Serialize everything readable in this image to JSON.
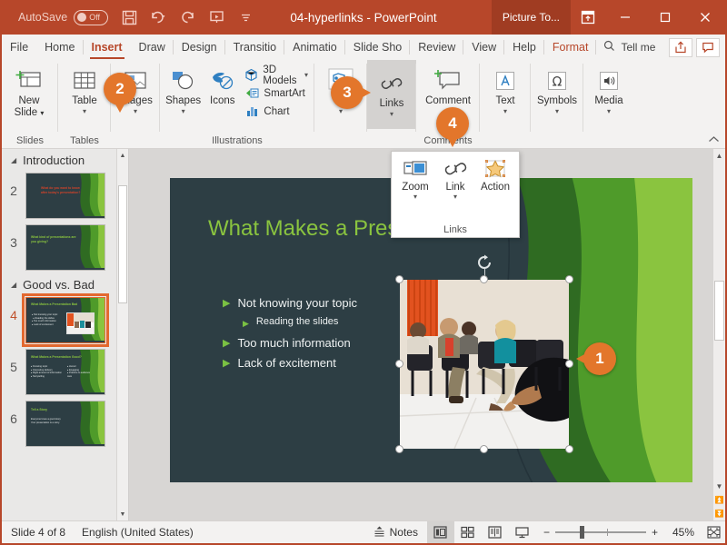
{
  "titlebar": {
    "autosave_label": "AutoSave",
    "autosave_state": "Off",
    "document_title": "04-hyperlinks  -  PowerPoint",
    "contextual_tab": "Picture To...",
    "icons": {
      "save": "save-icon",
      "undo": "undo-icon",
      "redo": "redo-icon",
      "present": "start-presentation-icon",
      "more": "quick-access-more-icon",
      "ribbon_display": "ribbon-display-options-icon",
      "minimize": "minimize-icon",
      "maximize": "maximize-icon",
      "close": "close-icon"
    }
  },
  "tabs": {
    "items": [
      {
        "label": "File",
        "active": false
      },
      {
        "label": "Home",
        "active": false
      },
      {
        "label": "Insert",
        "active": true
      },
      {
        "label": "Draw",
        "active": false
      },
      {
        "label": "Design",
        "active": false
      },
      {
        "label": "Transitio",
        "active": false
      },
      {
        "label": "Animatio",
        "active": false
      },
      {
        "label": "Slide Sho",
        "active": false
      },
      {
        "label": "Review",
        "active": false
      },
      {
        "label": "View",
        "active": false
      },
      {
        "label": "Help",
        "active": false
      },
      {
        "label": "Format",
        "active": false
      }
    ],
    "tell_me": "Tell me",
    "share_icon": "share-icon",
    "comments_icon": "comments-icon"
  },
  "ribbon": {
    "groups": [
      {
        "label": "Slides",
        "buttons": [
          {
            "label": "New\nSlide",
            "caret": true,
            "icon": "new-slide-icon"
          }
        ]
      },
      {
        "label": "Tables",
        "buttons": [
          {
            "label": "Table",
            "caret": true,
            "icon": "table-icon"
          }
        ]
      },
      {
        "label": "",
        "buttons": [
          {
            "label": "Images",
            "caret": true,
            "icon": "images-icon"
          }
        ]
      },
      {
        "label": "Illustrations",
        "buttons": [
          {
            "label": "Shapes",
            "caret": true,
            "icon": "shapes-icon"
          },
          {
            "label": "Icons",
            "caret": false,
            "icon": "icons-icon"
          }
        ],
        "small_items": [
          {
            "label": "3D Models",
            "icon": "3d-models-icon",
            "caret": true
          },
          {
            "label": "SmartArt",
            "icon": "smartart-icon",
            "caret": false
          },
          {
            "label": "Chart",
            "icon": "chart-icon",
            "caret": false
          }
        ]
      },
      {
        "label": "",
        "buttons": [
          {
            "label": "",
            "caret": true,
            "icon": "add-ins-icon"
          }
        ]
      },
      {
        "label": "",
        "buttons": [
          {
            "label": "Links",
            "caret": true,
            "icon": "links-icon",
            "selected": true
          }
        ]
      },
      {
        "label": "Comments",
        "buttons": [
          {
            "label": "Comment",
            "caret": false,
            "icon": "new-comment-icon"
          }
        ]
      },
      {
        "label": "",
        "buttons": [
          {
            "label": "Text",
            "caret": true,
            "icon": "text-icon"
          }
        ]
      },
      {
        "label": "",
        "buttons": [
          {
            "label": "Symbols",
            "caret": true,
            "icon": "symbols-icon"
          }
        ]
      },
      {
        "label": "",
        "buttons": [
          {
            "label": "Media",
            "caret": true,
            "icon": "media-icon"
          }
        ]
      }
    ],
    "collapse_icon": "collapse-ribbon-icon"
  },
  "links_menu": {
    "group_label": "Links",
    "items": [
      {
        "label": "Zoom",
        "caret": true,
        "icon": "zoom-link-icon"
      },
      {
        "label": "Link",
        "caret": true,
        "icon": "hyperlink-icon"
      },
      {
        "label": "Action",
        "caret": false,
        "icon": "action-star-icon"
      }
    ]
  },
  "callouts": [
    {
      "number": "1"
    },
    {
      "number": "2"
    },
    {
      "number": "3"
    },
    {
      "number": "4"
    }
  ],
  "thumbnails": {
    "sections": [
      {
        "title": "Introduction"
      },
      {
        "title": "Good vs. Bad"
      }
    ],
    "slides": [
      {
        "number": "2",
        "title": "What do you want to know after today's presentation?",
        "current": false,
        "title_color": "#d0432a"
      },
      {
        "number": "3",
        "title": "What kind of presentations are you giving?",
        "current": false,
        "title_color": "#8ac43f"
      },
      {
        "number": "4",
        "title": "What Makes a Presentation Bad",
        "current": true,
        "title_color": "#8ac43f"
      },
      {
        "number": "5",
        "title": "What Makes a Presentation Good?",
        "current": false,
        "title_color": "#8ac43f"
      },
      {
        "number": "6",
        "title": "Tell a Story",
        "current": false,
        "title_color": "#8ac43f"
      }
    ]
  },
  "slide": {
    "title": "What Makes a Presentation Bad",
    "bullets": [
      {
        "text": "Not knowing your topic",
        "level": 1
      },
      {
        "text": "Reading the slides",
        "level": 2
      },
      {
        "text": "Too much information",
        "level": 1
      },
      {
        "text": "Lack of excitement",
        "level": 1
      }
    ],
    "picture_alt": "bored-audience-photo",
    "rotate_handle": "rotate-handle-icon"
  },
  "statusbar": {
    "slide_counter": "Slide 4 of 8",
    "language": "English (United States)",
    "notes_label": "Notes",
    "zoom_percent": "45%",
    "views": [
      {
        "name": "normal-view",
        "active": true
      },
      {
        "name": "slide-sorter-view",
        "active": false
      },
      {
        "name": "reading-view",
        "active": false
      },
      {
        "name": "slide-show-view",
        "active": false
      }
    ],
    "zoom_out_label": "−",
    "zoom_in_label": "+",
    "fit_icon": "fit-slide-to-window-icon"
  },
  "colors": {
    "accent": "#b7472a",
    "callout": "#e3762b",
    "slide_bg": "#2d3e44",
    "slide_green": "#8ac43f"
  }
}
